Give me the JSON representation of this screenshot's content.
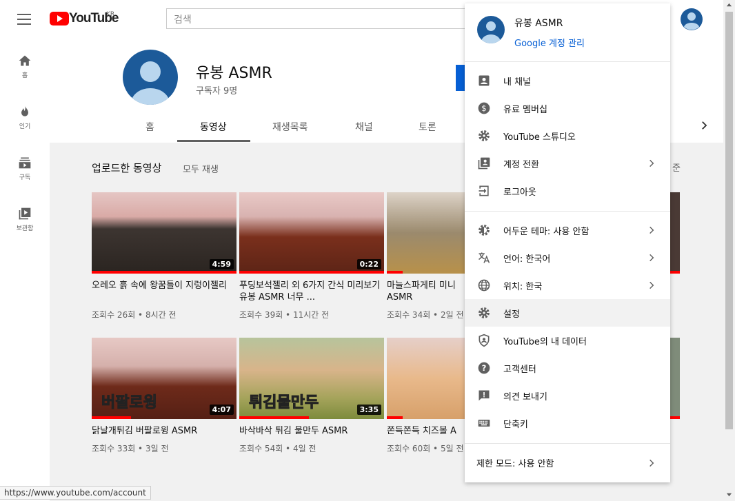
{
  "header": {
    "logo_text": "YouTube",
    "logo_region": "KR",
    "search_placeholder": "검색"
  },
  "guide": {
    "items": [
      {
        "label": "홈",
        "icon": "home-icon"
      },
      {
        "label": "인기",
        "icon": "fire-icon"
      },
      {
        "label": "구독",
        "icon": "subscriptions-icon"
      },
      {
        "label": "보관함",
        "icon": "library-icon"
      }
    ]
  },
  "channel": {
    "name": "유봉 ASMR",
    "subscribers": "구독자 9명",
    "tabs": [
      "홈",
      "동영상",
      "재생목록",
      "채널",
      "토론"
    ],
    "active_tab": "동영상"
  },
  "section": {
    "title": "업로드한 동영상",
    "play_all": "모두 재생",
    "sort_label": "준"
  },
  "videos": [
    {
      "title": "오레오 흙 속에 왕꿈틀이 지렁이젤리",
      "meta": "조회수 26회 • 8시간 전",
      "duration": "4:59",
      "progress": 1.0
    },
    {
      "title": "푸딩보석젤리 외 6가지 간식 미리보기 유봉 ASMR 너무 ...",
      "meta": "조회수 39회 • 11시간 전",
      "duration": "0:22",
      "progress": 1.0
    },
    {
      "title": "마늘스파게티 미니 ASMR",
      "meta": "조회수 34회 • 2일 전",
      "duration": "",
      "progress": 0.2
    },
    {
      "title": "닭날개튀김 버팔로윙 ASMR",
      "meta": "조회수 33회 • 3일 전",
      "duration": "4:07",
      "progress": 0.27,
      "overlay": "버팔로윙"
    },
    {
      "title": "바삭바삭 튀김 물만두 ASMR",
      "meta": "조회수 54회 • 4일 전",
      "duration": "3:35",
      "progress": 0.48,
      "overlay": "튀김물만두"
    },
    {
      "title": "쫀득쫀득 치즈볼 A",
      "meta": "조회수 60회 • 5일 전",
      "duration": "",
      "progress": 0.1
    }
  ],
  "account_menu": {
    "name": "유봉 ASMR",
    "manage": "Google 계정 관리",
    "group1": [
      {
        "label": "내 채널",
        "icon": "account-box-icon",
        "chevron": false
      },
      {
        "label": "유료 멤버십",
        "icon": "dollar-circle-icon",
        "chevron": false
      },
      {
        "label": "YouTube 스튜디오",
        "icon": "gear-icon",
        "chevron": false
      },
      {
        "label": "계정 전환",
        "icon": "switch-account-icon",
        "chevron": true
      },
      {
        "label": "로그아웃",
        "icon": "logout-icon",
        "chevron": false
      }
    ],
    "group2": [
      {
        "label": "어두운 테마: 사용 안함",
        "icon": "dark-theme-icon",
        "chevron": true
      },
      {
        "label": "언어: 한국어",
        "icon": "translate-icon",
        "chevron": true
      },
      {
        "label": "위치: 한국",
        "icon": "globe-icon",
        "chevron": true
      },
      {
        "label": "설정",
        "icon": "settings-icon",
        "chevron": false,
        "highlight": true
      },
      {
        "label": "YouTube의 내 데이터",
        "icon": "shield-person-icon",
        "chevron": false
      },
      {
        "label": "고객센터",
        "icon": "help-icon",
        "chevron": false
      },
      {
        "label": "의견 보내기",
        "icon": "feedback-icon",
        "chevron": false
      },
      {
        "label": "단축키",
        "icon": "keyboard-icon",
        "chevron": false
      }
    ],
    "restricted": "제한 모드: 사용 안함"
  },
  "status_url": "https://www.youtube.com/account",
  "colors": {
    "brand": "#ff0000",
    "link": "#065fd4",
    "avatar": "#2b6cb0"
  }
}
